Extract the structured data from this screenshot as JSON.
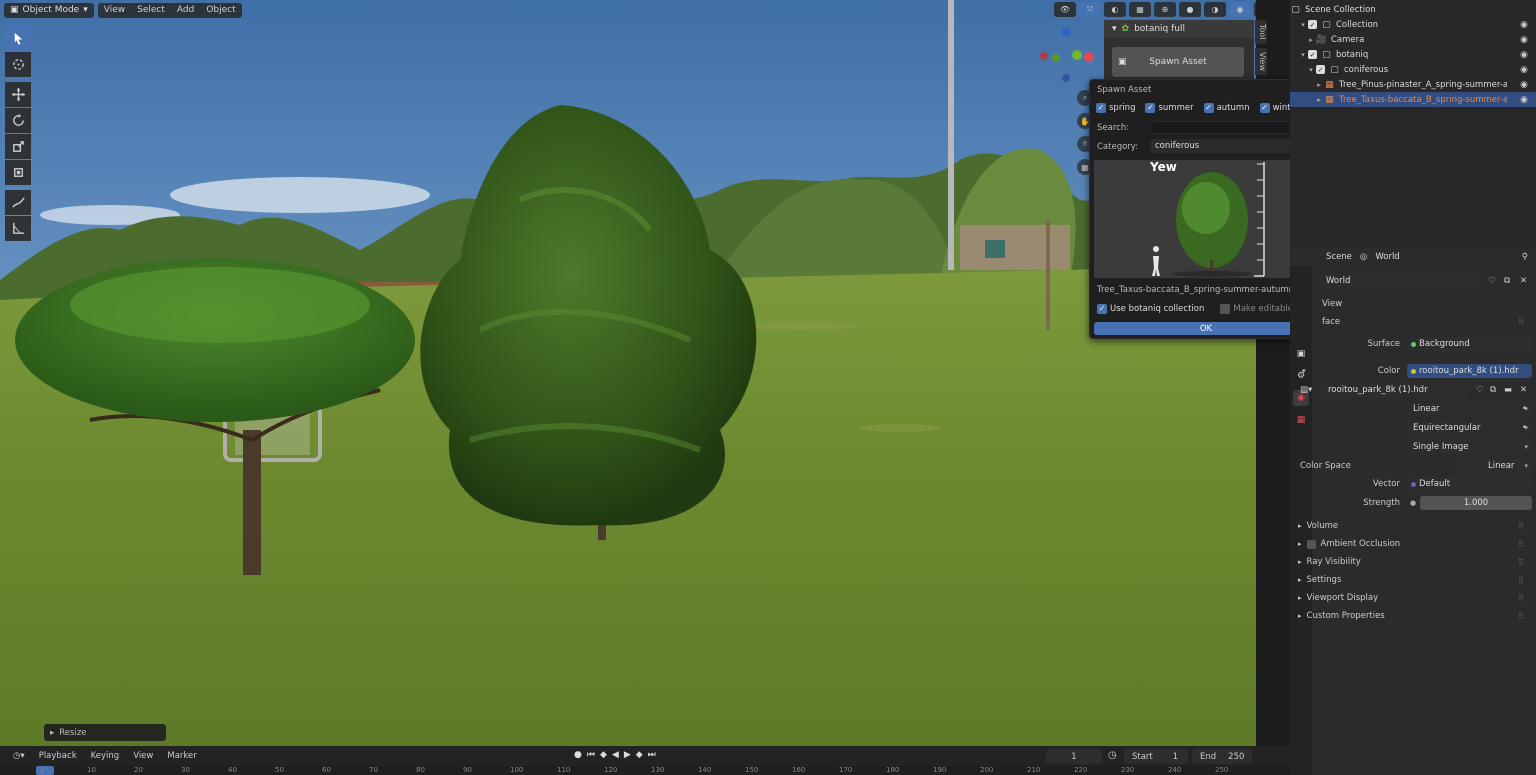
{
  "viewport_header": {
    "mode": "Object Mode",
    "menus": [
      "View",
      "Select",
      "Add",
      "Object"
    ]
  },
  "side_tabs": [
    "Tool",
    "View"
  ],
  "npanel": {
    "addon_title": "botaniq full",
    "spawn_button": "Spawn Asset"
  },
  "popup": {
    "title": "Spawn Asset",
    "seasons": [
      {
        "label": "spring",
        "checked": true
      },
      {
        "label": "summer",
        "checked": true
      },
      {
        "label": "autumn",
        "checked": true
      },
      {
        "label": "winter",
        "checked": true
      }
    ],
    "search_label": "Search:",
    "search_value": "",
    "category_label": "Category:",
    "category_value": "coniferous",
    "preview_title": "Yew",
    "asset_name": "Tree_Taxus-baccata_B_spring-summer-autumn",
    "use_collection_label": "Use botaniq collection",
    "use_collection_checked": true,
    "make_editable_label": "Make editable",
    "make_editable_checked": false,
    "ok_label": "OK"
  },
  "resize_panel": "Resize",
  "timeline": {
    "menus": [
      "Playback",
      "Keying",
      "View",
      "Marker"
    ],
    "current_frame": "1",
    "start_label": "Start",
    "start_value": "1",
    "end_label": "End",
    "end_value": "250",
    "ruler": [
      "1",
      "10",
      "20",
      "30",
      "40",
      "50",
      "60",
      "70",
      "80",
      "90",
      "100",
      "110",
      "120",
      "130",
      "140",
      "150",
      "160",
      "170",
      "180",
      "190",
      "200",
      "210",
      "220",
      "230",
      "240",
      "250"
    ]
  },
  "outliner": {
    "title": "Scene Collection",
    "rows": [
      {
        "label": "Collection",
        "indent": 1,
        "icon": "collection-icon",
        "check": true
      },
      {
        "label": "Camera",
        "indent": 2,
        "icon": "camera-icon",
        "check": false
      },
      {
        "label": "botaniq",
        "indent": 1,
        "icon": "collection-icon",
        "check": true
      },
      {
        "label": "coniferous",
        "indent": 2,
        "icon": "collection-icon",
        "check": true
      },
      {
        "label": "Tree_Pinus-pinaster_A_spring-summer-autu",
        "indent": 3,
        "icon": "object-icon",
        "check": false
      },
      {
        "label": "Tree_Taxus-baccata_B_spring-summer-autu",
        "indent": 3,
        "icon": "object-icon",
        "check": false,
        "selected": true
      }
    ]
  },
  "properties": {
    "breadcrumb_scene": "Scene",
    "breadcrumb_world": "World",
    "world_name": "World",
    "rows": {
      "view_label": "View",
      "surface_panel": "face",
      "surface_label": "Surface",
      "surface_value": "Background",
      "color_label": "Color",
      "color_value": "rooitou_park_8k (1).hdr",
      "image_value": "rooitou_park_8k (1).hdr",
      "interp_value": "Linear",
      "projection_value": "Equirectangular",
      "source_value": "Single Image",
      "colorspace_label": "Color Space",
      "colorspace_value": "Linear",
      "vector_label": "Vector",
      "vector_value": "Default",
      "strength_label": "Strength",
      "strength_value": "1.000"
    },
    "sections": [
      "Volume",
      "Ambient Occlusion",
      "Ray Visibility",
      "Settings",
      "Viewport Display",
      "Custom Properties"
    ]
  },
  "colors": {
    "accent": "#4772b3",
    "selected_row": "#334d80",
    "selected_text": "#e8864a",
    "socket_yellow": "#c7c729",
    "socket_green": "#63c763",
    "socket_purple": "#6363c7"
  }
}
